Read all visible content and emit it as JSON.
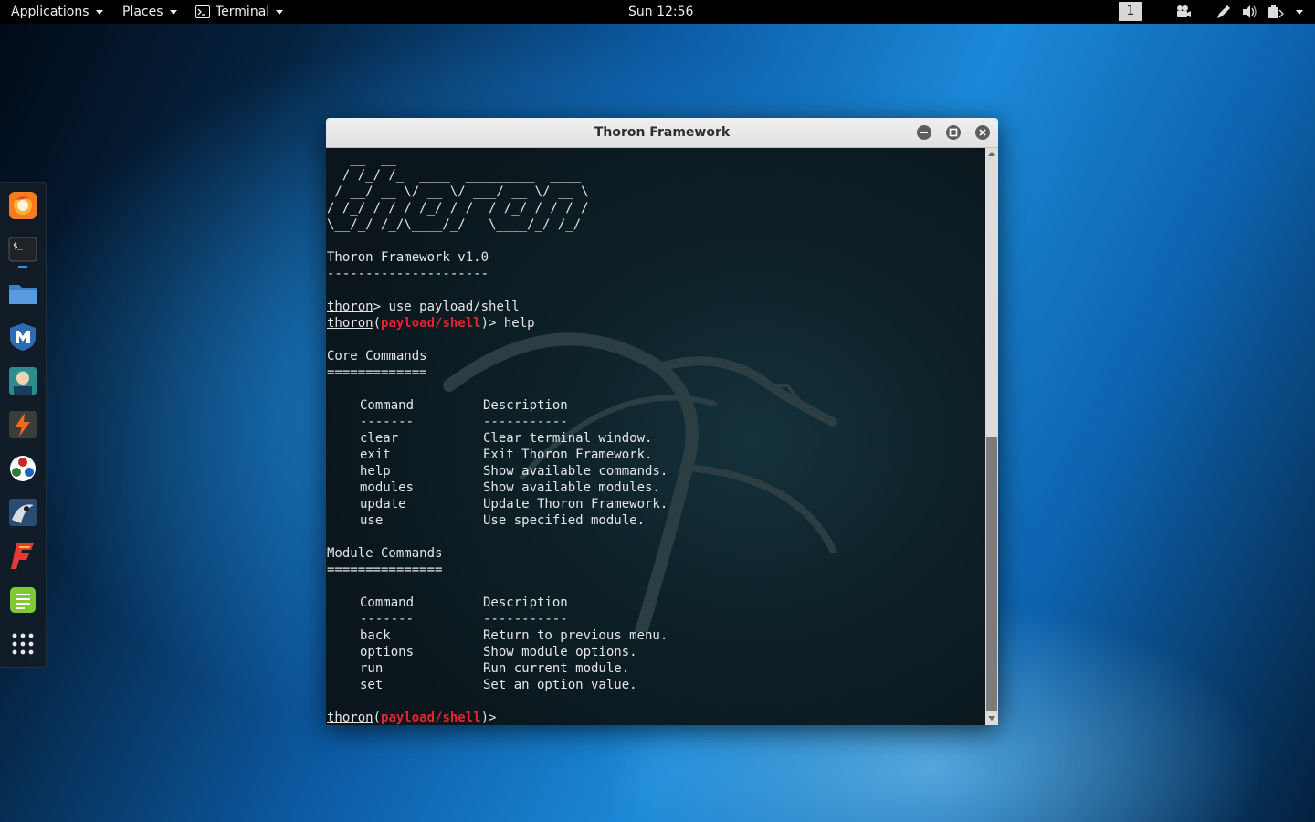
{
  "topbar": {
    "applications_label": "Applications",
    "places_label": "Places",
    "terminal_label": "Terminal",
    "clock": "Sun 12:56",
    "workspace": "1"
  },
  "dock": {
    "apps": [
      "firefox-icon",
      "terminal-icon",
      "files-icon",
      "metasploit-icon",
      "armitage-icon",
      "burpsuite-icon",
      "maltego-icon",
      "beef-icon",
      "faraday-icon",
      "text-editor-icon",
      "show-applications-icon"
    ]
  },
  "window": {
    "title": "Thoron Framework"
  },
  "terminal": {
    "banner": [
      "   __  __",
      "  / /_/ /_  ____  _________  ____",
      " / __/ __ \\/ __ \\/ ___/ __ \\/ __ \\",
      "/ /_/ / / / /_/ / /  / /_/ / / / /",
      "\\__/_/ /_/\\____/_/   \\____/_/ /_/"
    ],
    "version": "Thoron Framework v1.0",
    "version_rule": "---------------------",
    "prompt": "thoron",
    "module": "payload/shell",
    "cmd1": " use payload/shell",
    "cmd2": " help",
    "core_title": "Core Commands",
    "core_rule": "=============",
    "col_command": "Command",
    "col_description": "Description",
    "col_command_rule": "-------",
    "col_description_rule": "-----------",
    "core_commands": [
      {
        "cmd": "clear",
        "desc": "Clear terminal window."
      },
      {
        "cmd": "exit",
        "desc": "Exit Thoron Framework."
      },
      {
        "cmd": "help",
        "desc": "Show available commands."
      },
      {
        "cmd": "modules",
        "desc": "Show available modules."
      },
      {
        "cmd": "update",
        "desc": "Update Thoron Framework."
      },
      {
        "cmd": "use",
        "desc": "Use specified module."
      }
    ],
    "module_title": "Module Commands",
    "module_rule": "===============",
    "module_commands": [
      {
        "cmd": "back",
        "desc": "Return to previous menu."
      },
      {
        "cmd": "options",
        "desc": "Show module options."
      },
      {
        "cmd": "run",
        "desc": "Run current module."
      },
      {
        "cmd": "set",
        "desc": "Set an option value."
      }
    ]
  }
}
